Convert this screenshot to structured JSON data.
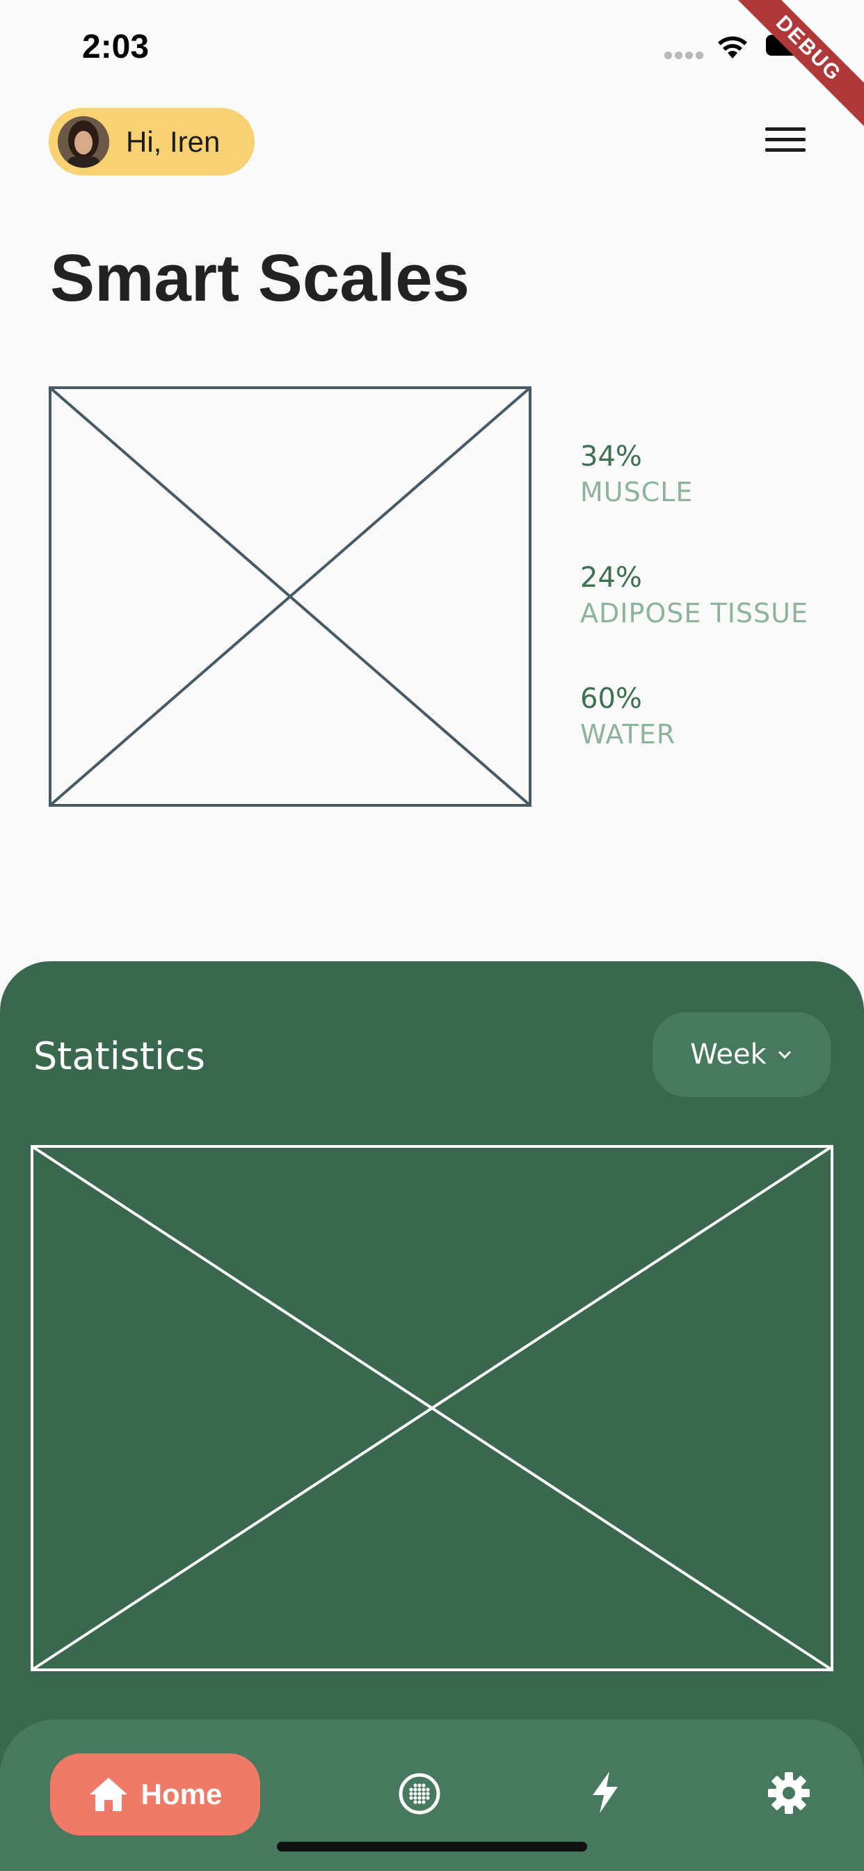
{
  "status_bar": {
    "time": "2:03",
    "debug_banner": "DEBUG"
  },
  "header": {
    "greeting": "Hi, Iren",
    "menu_icon": "hamburger-menu-icon",
    "avatar": "user-avatar"
  },
  "page": {
    "title": "Smart Scales"
  },
  "body_stats": [
    {
      "value": "34%",
      "label": "MUSCLE"
    },
    {
      "value": "24%",
      "label": "ADIPOSE TISSUE"
    },
    {
      "value": "60%",
      "label": "WATER"
    }
  ],
  "statistics": {
    "title": "Statistics",
    "period_selected": "Week"
  },
  "bottom_nav": {
    "items": [
      {
        "label": "Home",
        "icon": "home-icon",
        "active": true
      },
      {
        "label": "",
        "icon": "globe-grid-icon",
        "active": false
      },
      {
        "label": "",
        "icon": "lightning-icon",
        "active": false
      },
      {
        "label": "",
        "icon": "gear-icon",
        "active": false
      }
    ]
  },
  "colors": {
    "accent_yellow": "#f8d272",
    "panel_green": "#39684f",
    "nav_green": "#46795d",
    "home_coral": "#ef7a67",
    "stat_green": "#3d7150"
  }
}
